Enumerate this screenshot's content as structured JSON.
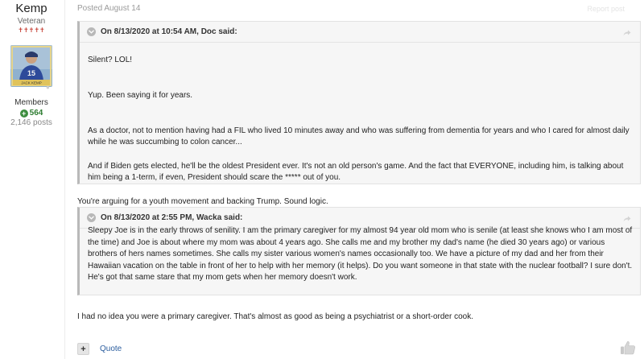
{
  "author": {
    "name": "Kemp",
    "rank": "Veteran",
    "rank_pips": "✝✝✝✝✝",
    "avatar_caption": "JACK KEMP",
    "group": "Members",
    "reputation": "564",
    "post_count": "2,146 posts"
  },
  "post": {
    "posted": "Posted August 14",
    "report_label": "Report post",
    "quote1": {
      "header": "On 8/13/2020 at 10:54 AM, Doc said:",
      "paragraphs": [
        "Silent?  LOL!",
        "Yup.  Been saying it for years.",
        "As a doctor, not to mention having had a FIL who lived 10 minutes away and who was suffering from dementia for years and who I cared for almost daily while he was succumbing to colon cancer...",
        "And if Biden gets elected, he'll be the oldest President ever.  It's not an old person's game.  And the fact that EVERYONE, including him, is talking about him being a 1-term, if even, President should scare the ***** out of you."
      ]
    },
    "reply1": "You're arguing for a youth movement and backing Trump. Sound logic.",
    "quote2": {
      "header": "On 8/13/2020 at 2:55 PM, Wacka said:",
      "paragraphs": [
        "Sleepy Joe is in the early throws of senility.  I am the primary caregiver for my almost 94 year old mom who is senile (at least she knows who I am most of the time) and Joe is about where my mom was about 4 years ago.  She calls me and my brother my dad's name  (he died 30 years ago) or various brothers of hers names sometimes.  She calls my sister various women's names occasionally too.  We have a picture of my dad and her from their Hawaiian vacation  on the table in front of her  to help with her memory (it helps).    Do you want someone in that state  with the nuclear football? I sure don't.  He's got that same stare that my mom gets when her memory doesn't work."
      ]
    },
    "reply2": "I had no idea you were a primary caregiver. That's almost as good as being a psychiatrist or a short-order cook.",
    "footer": {
      "multiquote_label": "+",
      "quote_label": "Quote"
    }
  },
  "icons": {
    "toggle": "chevron-down-icon",
    "share": "share-icon",
    "like": "thumbs-up-icon",
    "reputation": "plus-circle-icon"
  },
  "colors": {
    "rank_pips": "#c43a2f",
    "reputation": "#2f7d32",
    "link": "#2b5d9e",
    "quote_bg": "#f6f6f6"
  }
}
